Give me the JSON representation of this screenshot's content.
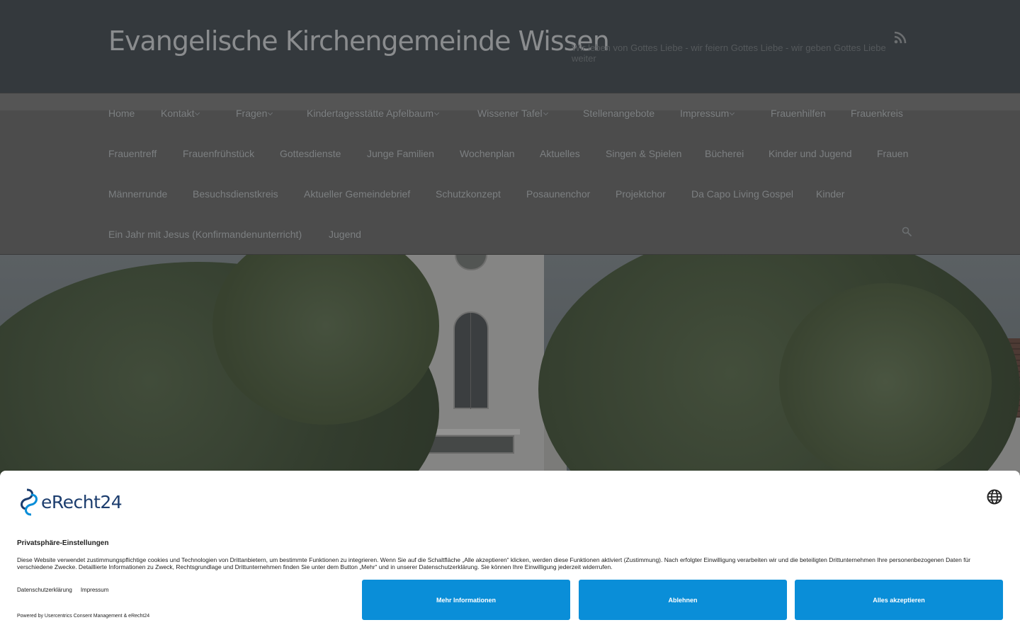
{
  "header": {
    "title": "Evangelische Kirchengemeinde Wissen",
    "tagline": "Wir leben von Gottes Liebe - wir feiern Gottes Liebe - wir geben Gottes Liebe weiter",
    "rss_icon": "rss-icon"
  },
  "nav": {
    "items": [
      {
        "label": "Home",
        "has_submenu": false
      },
      {
        "label": "Kontakt",
        "has_submenu": true
      },
      {
        "label": "Fragen",
        "has_submenu": true
      },
      {
        "label": "Kindertagesstätte Apfelbaum",
        "has_submenu": true
      },
      {
        "label": "Wissener Tafel",
        "has_submenu": true
      },
      {
        "label": "Stellenangebote",
        "has_submenu": false
      },
      {
        "label": "Impressum",
        "has_submenu": true
      },
      {
        "label": "Frauenhilfen",
        "has_submenu": false
      },
      {
        "label": "Frauenkreis",
        "has_submenu": false
      },
      {
        "label": "Frauentreff",
        "has_submenu": false
      },
      {
        "label": "Frauenfrühstück",
        "has_submenu": false
      },
      {
        "label": "Gottesdienste",
        "has_submenu": false
      },
      {
        "label": "Junge Familien",
        "has_submenu": false
      },
      {
        "label": "Wochenplan",
        "has_submenu": false
      },
      {
        "label": "Aktuelles",
        "has_submenu": false
      },
      {
        "label": "Singen & Spielen",
        "has_submenu": false
      },
      {
        "label": "Bücherei",
        "has_submenu": false
      },
      {
        "label": "Kinder und Jugend",
        "has_submenu": false
      },
      {
        "label": "Frauen",
        "has_submenu": false
      },
      {
        "label": "Männerrunde",
        "has_submenu": false
      },
      {
        "label": "Besuchsdienstkreis",
        "has_submenu": false
      },
      {
        "label": "Aktueller Gemeindebrief",
        "has_submenu": false
      },
      {
        "label": "Schutzkonzept",
        "has_submenu": false
      },
      {
        "label": "Posaunenchor",
        "has_submenu": false
      },
      {
        "label": "Projektchor",
        "has_submenu": false
      },
      {
        "label": "Da Capo Living Gospel",
        "has_submenu": false
      },
      {
        "label": "Kinder",
        "has_submenu": false
      },
      {
        "label": "Ein Jahr mit Jesus (Konfirmandenunterricht)",
        "has_submenu": false
      },
      {
        "label": "Jugend",
        "has_submenu": false
      }
    ],
    "search_icon": "search-icon"
  },
  "consent": {
    "brand": "eRecht24",
    "title": "Privatsphäre-Einstellungen",
    "text": "Diese Website verwendet zustimmungspflichtige cookies und Technologien von Drittanbietern, um bestimmte Funktionen zu integrieren. Wenn Sie auf die Schaltfläche „Alle akzeptieren“ klicken, werden diese Funktionen aktiviert (Zustimmung). Nach erfolgter Einwilligung verarbeiten wir und die beteiligten Drittunternehmen Ihre personenbezogenen Daten für verschiedene Zwecke. Detaillierte Informationen zu Zweck, Rechtsgrundlage und Drittunternehmen finden Sie unter dem Button „Mehr“ und in unserer Datenschutzerklärung. Sie können Ihre Einwilligung jederzeit widerrufen.",
    "links": [
      "Datenschutzerklärung",
      "Impressum"
    ],
    "powered_by": "Powered by Usercentrics Consent Management & eRecht24",
    "buttons": {
      "more": "Mehr Informationen",
      "decline": "Ablehnen",
      "accept": "Alles akzeptieren"
    },
    "button_color": "#0a8ed8"
  },
  "colors": {
    "header_bg": "#34393d",
    "nav_bg": "#4c4c4c",
    "nav_text": "#7c7f81",
    "overlay": "dimmed page behind consent banner"
  }
}
